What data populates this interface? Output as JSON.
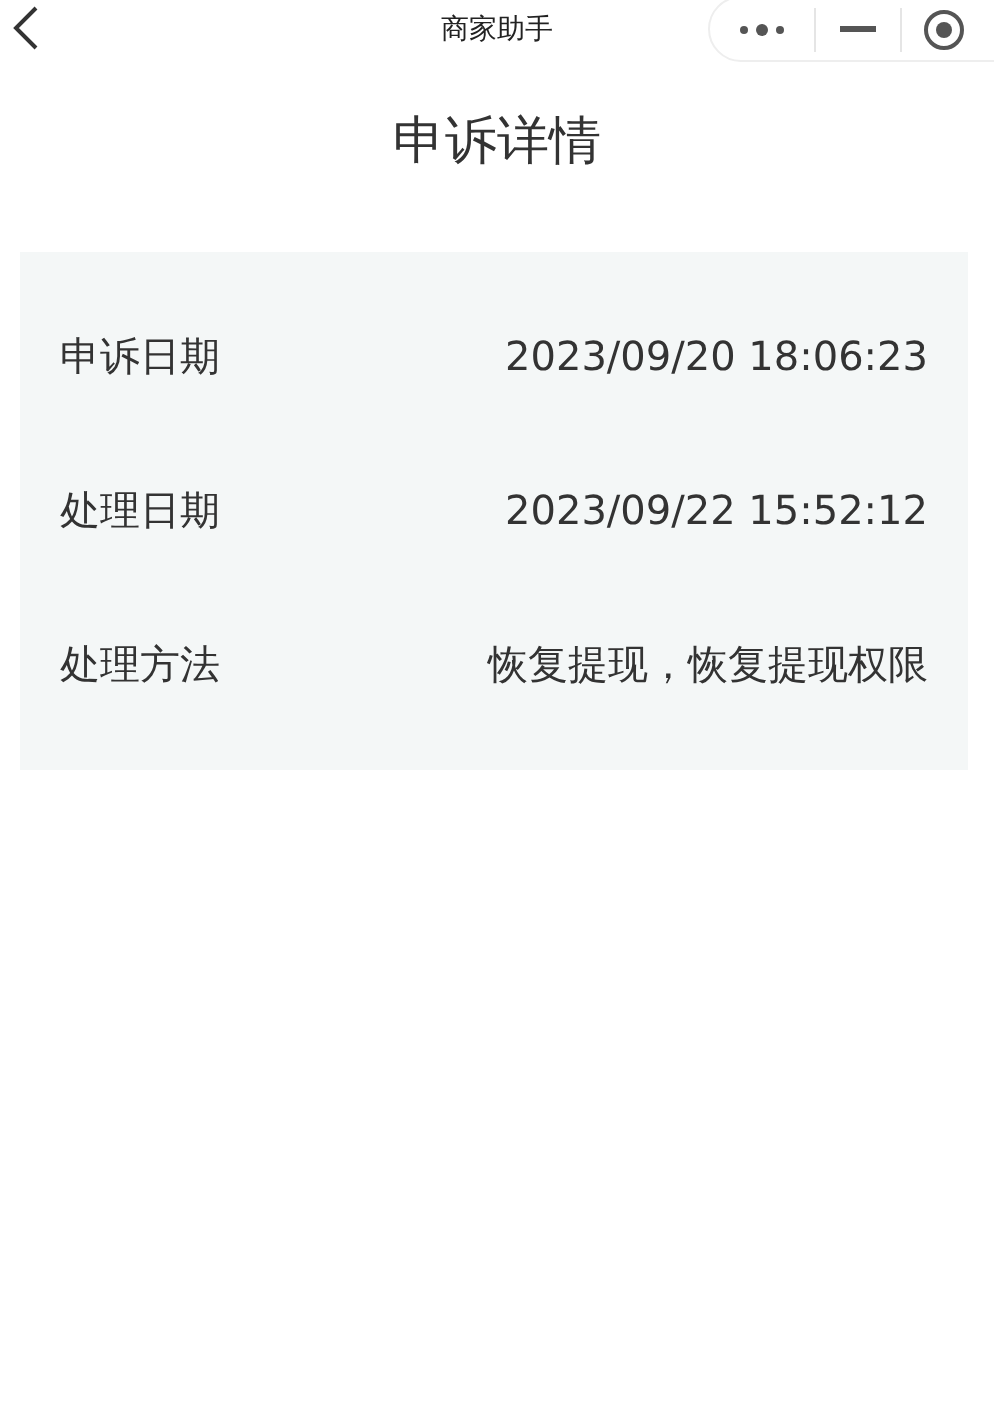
{
  "nav_bar": {
    "title": "商家助手"
  },
  "heading": "申诉详情",
  "details": [
    {
      "label": "申诉日期",
      "value": "2023/09/20 18:06:23"
    },
    {
      "label": "处理日期",
      "value": "2023/09/22 15:52:12"
    },
    {
      "label": "处理方法",
      "value": "恢复提现，恢复提现权限"
    }
  ]
}
